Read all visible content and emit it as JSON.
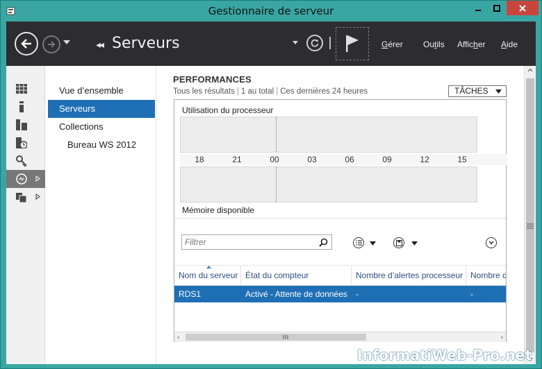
{
  "window": {
    "title": "Gestionnaire de serveur"
  },
  "header": {
    "breadcrumb_arrows": "◂◂",
    "breadcrumb_title": "Serveurs",
    "menu": [
      {
        "label": "Gérer",
        "accel": "G",
        "rest": "érer"
      },
      {
        "label": "Outils",
        "pre": "Ou",
        "accel": "t",
        "rest": "ils"
      },
      {
        "label": "Afficher",
        "pre": "Affic",
        "accel": "h",
        "rest": "er"
      },
      {
        "label": "Aide",
        "accel": "A",
        "rest": "ide"
      }
    ]
  },
  "iconbar": {
    "items": [
      "dashboard-icon",
      "local-server-icon",
      "all-servers-icon",
      "file-storage-icon",
      "ad-icon",
      "remote-desktop-icon",
      "iis-icon"
    ],
    "active_index": 5
  },
  "nav": {
    "items": [
      {
        "label": "Vue d’ensemble",
        "selected": false
      },
      {
        "label": "Serveurs",
        "selected": true
      },
      {
        "label": "Collections",
        "selected": false
      },
      {
        "label": "Bureau WS 2012",
        "selected": false,
        "sub": true
      }
    ]
  },
  "performances": {
    "title": "PERFORMANCES",
    "sub_results": "Tous les résultats",
    "sub_count": "1 au total",
    "sub_period": "Ces dernières 24 heures",
    "tasks_label": "TÂCHES",
    "cpu_label": "Utilisation du processeur",
    "mem_label": "Mémoire disponible",
    "ticks": [
      "18",
      "21",
      "00",
      "03",
      "06",
      "09",
      "12",
      "15"
    ],
    "filter_placeholder": "Filtrer"
  },
  "grid": {
    "columns": [
      "Nom du serveur",
      "État du compteur",
      "Nombre d’alertes processeur",
      "Nombre d"
    ],
    "rows": [
      [
        "RDS1",
        "Activé - Attente de données",
        "-",
        "-"
      ]
    ]
  },
  "watermark": "InformatiWeb-Pro.net",
  "colors": {
    "accent": "#1f6fb5",
    "titlebar": "#3aa6a3",
    "header": "#2d2d30",
    "close": "#c7463c"
  }
}
